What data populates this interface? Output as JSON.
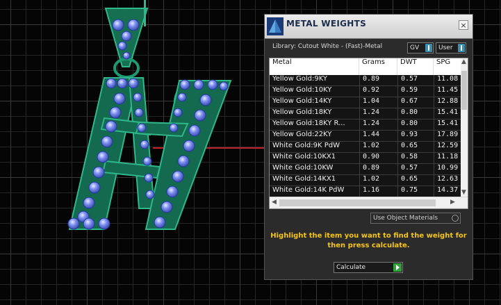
{
  "panel": {
    "title": "METAL WEIGHTS",
    "library": "Library: Cutout White - (Fast)-Metal",
    "toggle_gv": "GV",
    "toggle_user": "User",
    "close": "×",
    "use_object_materials": "Use Object Materials",
    "hint": "Highlight the item you want to find the weight for then press calculate.",
    "calculate": "Calculate"
  },
  "table": {
    "headers": [
      "Metal",
      "Grams",
      "DWT",
      "SPG"
    ],
    "rows": [
      {
        "metal": "Yellow Gold:9KY",
        "grams": "0.89",
        "dwt": "0.57",
        "spg": "11.08"
      },
      {
        "metal": "Yellow Gold:10KY",
        "grams": "0.92",
        "dwt": "0.59",
        "spg": "11.45"
      },
      {
        "metal": "Yellow Gold:14KY",
        "grams": "1.04",
        "dwt": "0.67",
        "spg": "12.88"
      },
      {
        "metal": "Yellow Gold:18KY",
        "grams": "1.24",
        "dwt": "0.80",
        "spg": "15.41"
      },
      {
        "metal": "Yellow Gold:18KY R...",
        "grams": "1.24",
        "dwt": "0.80",
        "spg": "15.41"
      },
      {
        "metal": "Yellow Gold:22KY",
        "grams": "1.44",
        "dwt": "0.93",
        "spg": "17.89"
      },
      {
        "metal": "White Gold:9K PdW",
        "grams": "1.02",
        "dwt": "0.65",
        "spg": "12.59"
      },
      {
        "metal": "White Gold:10KX1",
        "grams": "0.90",
        "dwt": "0.58",
        "spg": "11.18"
      },
      {
        "metal": "White Gold:10KW",
        "grams": "0.89",
        "dwt": "0.57",
        "spg": "10.99"
      },
      {
        "metal": "White Gold:14KX1",
        "grams": "1.02",
        "dwt": "0.65",
        "spg": "12.63"
      },
      {
        "metal": "White Gold:14K PdW",
        "grams": "1.16",
        "dwt": "0.75",
        "spg": "14.37"
      }
    ]
  },
  "colors": {
    "highlight": "#f5c517",
    "model": "#1d8a66",
    "axis": "#c0212a"
  }
}
